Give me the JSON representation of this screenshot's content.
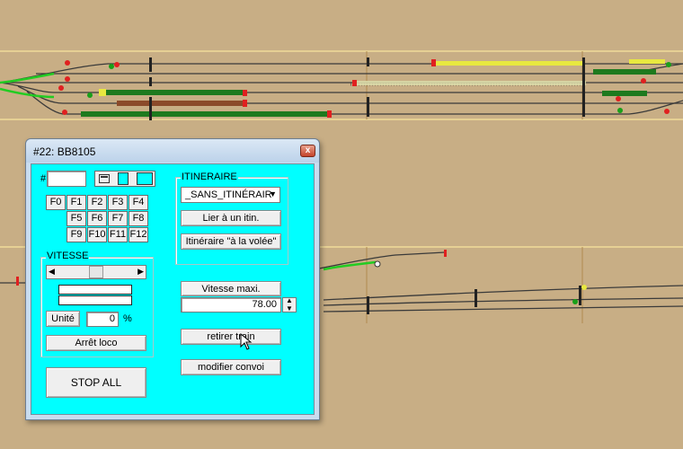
{
  "window": {
    "title": "#22: BB8105",
    "close_label": "x"
  },
  "address": {
    "label": "#",
    "value": ""
  },
  "functions": {
    "row1": [
      "F0",
      "F1",
      "F2",
      "F3",
      "F4"
    ],
    "row2": [
      "F5",
      "F6",
      "F7",
      "F8"
    ],
    "row3": [
      "F9",
      "F10",
      "F11",
      "F12"
    ]
  },
  "itinerary": {
    "group_label": "ITINERAIRE",
    "selected": "_SANS_ITINÉRAIR",
    "link_button": "Lier à un itin.",
    "flying_button": "Itinéraire \"à la volée\""
  },
  "speed": {
    "group_label": "VITESSE",
    "unit_button": "Unité",
    "speed_value": "0",
    "unit_symbol": "%",
    "stop_button": "Arrêt loco",
    "slider_level": 0.5
  },
  "max_speed": {
    "label": "Vitesse maxi.",
    "value": "78.00"
  },
  "actions": {
    "remove_train": "retirer train",
    "modify_convoy": "modifier convoi",
    "stop_all": "STOP ALL"
  },
  "colors": {
    "client_bg": "#00ffff",
    "terrain": "#c8ae85",
    "signal_red": "#e02020",
    "signal_green": "#19a019",
    "track_occupied_green": "#1e7a1e",
    "track_yellow": "#e8e840",
    "track_brown": "#8b4a2a"
  }
}
